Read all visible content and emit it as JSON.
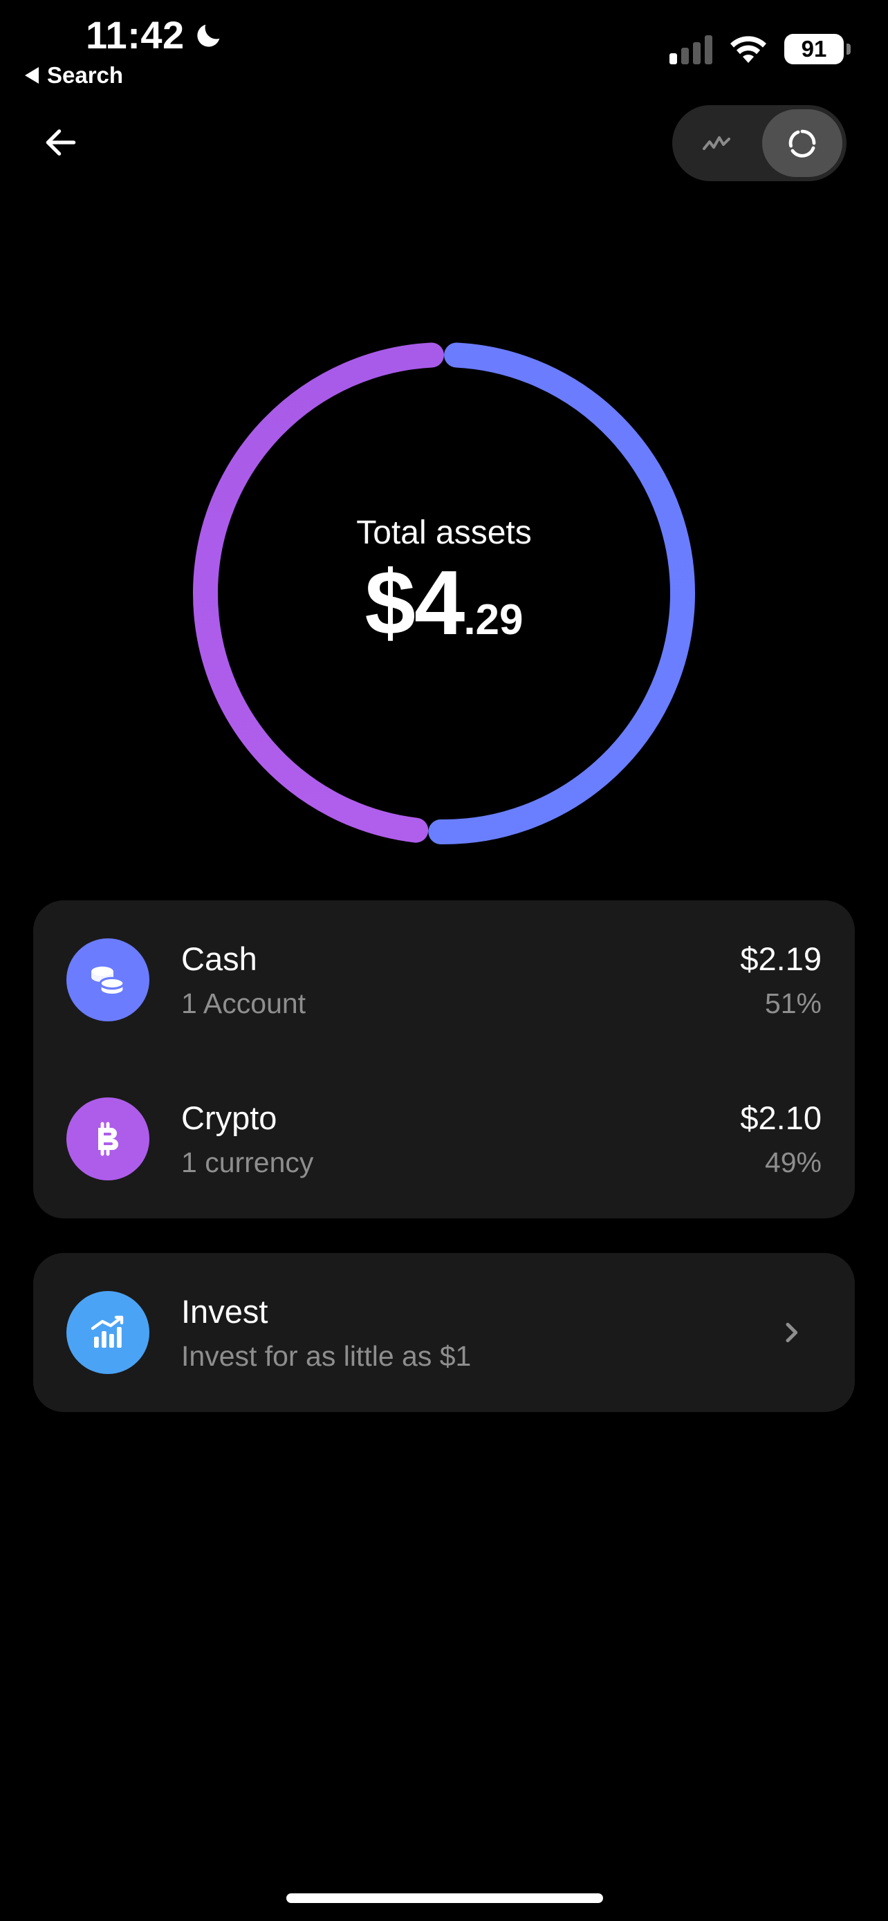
{
  "status_bar": {
    "time": "11:42",
    "back_app": "Search",
    "battery": "91",
    "signal_bars_active": 1,
    "signal_bars_total": 4
  },
  "icons": {
    "back": "arrow-left-icon",
    "line_view": "line-chart-icon",
    "ring_view": "donut-chart-icon",
    "cash": "coins-icon",
    "crypto": "bitcoin-icon",
    "invest": "bar-chart-icon",
    "chevron": "chevron-right-icon"
  },
  "summary": {
    "label": "Total assets",
    "amount_whole": "$4",
    "amount_cents": ".29"
  },
  "chart_data": {
    "type": "pie",
    "style": "donut",
    "categories": [
      "Cash",
      "Crypto"
    ],
    "values": [
      2.19,
      2.1
    ],
    "colors": [
      "#6B7CFF",
      "#AE5DEB"
    ]
  },
  "assets": [
    {
      "title": "Cash",
      "subtitle": "1 Account",
      "amount": "$2.19",
      "percent": "51%",
      "color": "#6B7CFF"
    },
    {
      "title": "Crypto",
      "subtitle": "1 currency",
      "amount": "$2.10",
      "percent": "49%",
      "color": "#AE5DEB"
    }
  ],
  "invest": {
    "title": "Invest",
    "subtitle": "Invest for as little as $1",
    "color": "#4BA3F5"
  }
}
